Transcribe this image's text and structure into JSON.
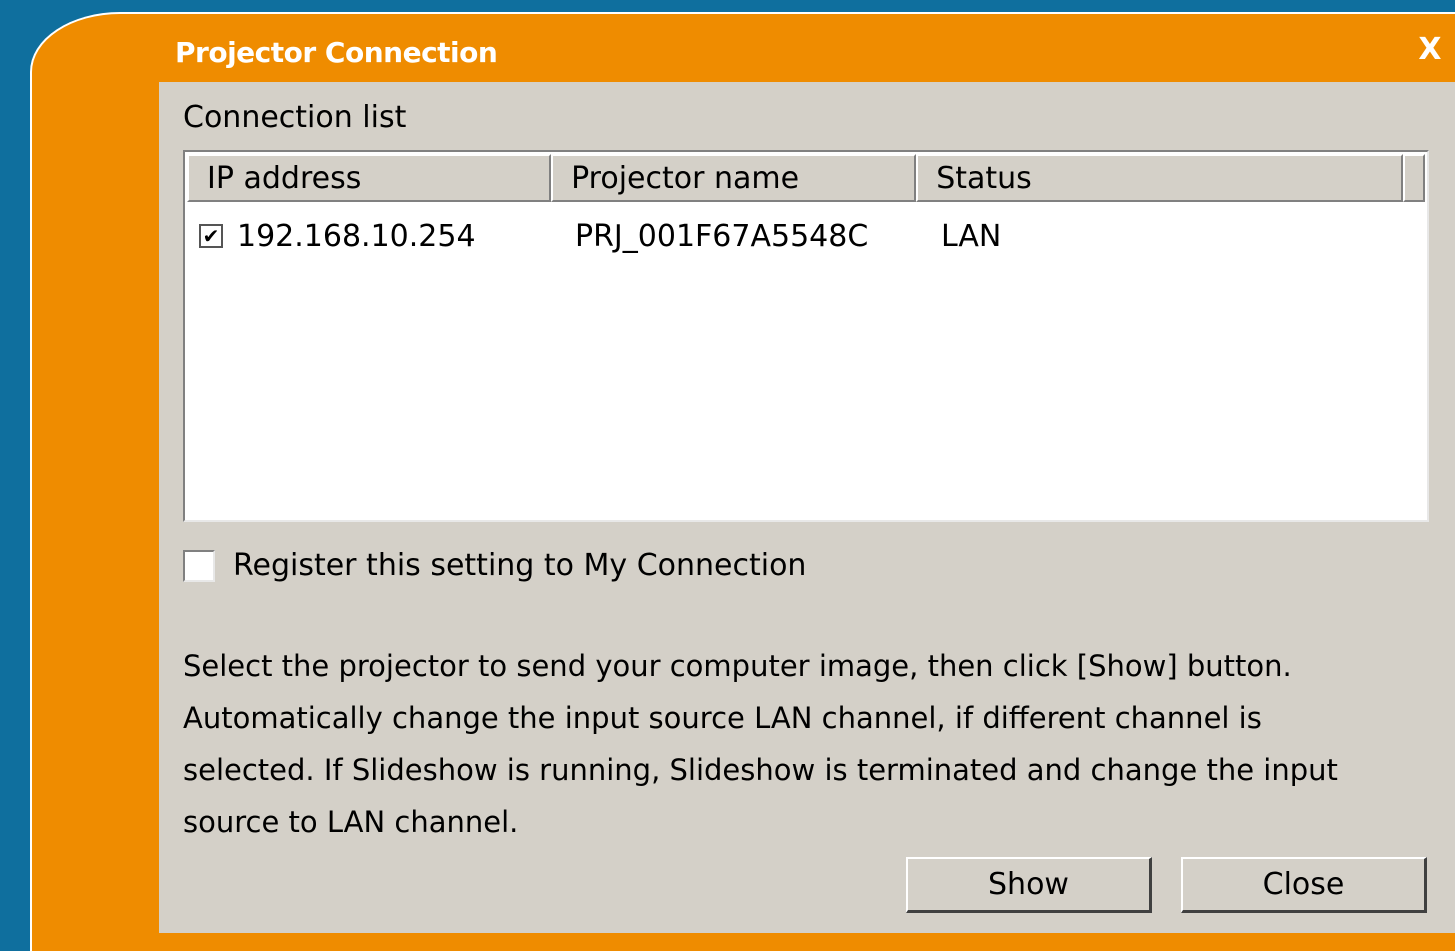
{
  "window": {
    "title": "Projector Connection",
    "close_glyph": "X"
  },
  "connection_list": {
    "label": "Connection list",
    "columns": [
      "IP address",
      "Projector name",
      "Status"
    ],
    "rows": [
      {
        "checked": true,
        "ip": "192.168.10.254",
        "name": "PRJ_001F67A5548C",
        "status": "LAN"
      }
    ]
  },
  "register": {
    "label": "Register this setting to My Connection",
    "checked": false
  },
  "description": {
    "lines": [
      "Select the projector to send your computer image, then click [Show] button.",
      "Automatically change the input source LAN channel, if different channel is",
      "selected. If Slideshow is running, Slideshow is terminated and change the input",
      "source to LAN channel."
    ]
  },
  "buttons": {
    "show": "Show",
    "close": "Close"
  },
  "colors": {
    "accent": "#ef8c00",
    "desktop": "#0f6f9e",
    "panel": "#d4d0c8"
  }
}
